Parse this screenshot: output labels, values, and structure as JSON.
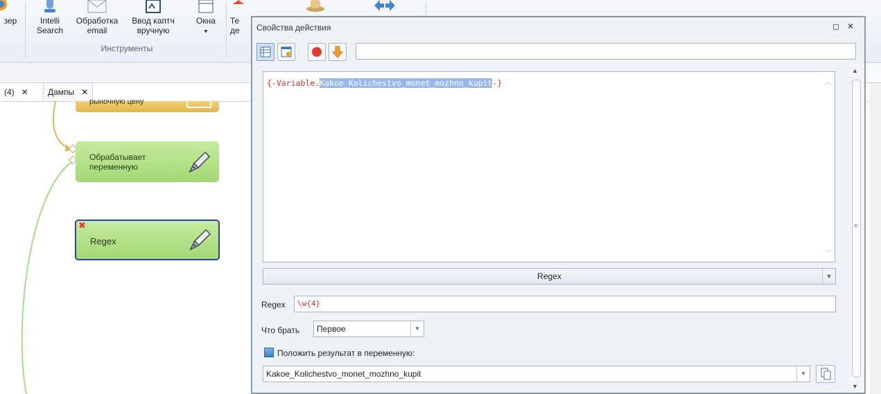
{
  "ribbon": {
    "browser_label": "зер",
    "intelli_line1": "Intelli",
    "intelli_line2": "Search",
    "email_line1": "Обработка",
    "email_line2": "email",
    "captcha_line1": "Ввод каптч",
    "captcha_line2": "вручную",
    "windows_label": "Окна",
    "windows_arrow": "▾",
    "partial_line1": "Те",
    "partial_line2": "де",
    "group_tools": "Инструменты"
  },
  "tabs": {
    "tab1_label": "(4)",
    "tab2_label": "Дампы",
    "close_glyph": "✕"
  },
  "canvas": {
    "node_top_label": "рыночную цену",
    "node_process_label_line1": "Обрабатывает",
    "node_process_label_line2": "переменную",
    "node_regex_label": "Regex"
  },
  "dialog": {
    "title": "Свойства действия",
    "restore_glyph": "◻",
    "close_glyph": "✕",
    "toolbar_input_value": "",
    "code_prefix": "{-Variable.",
    "code_highlight": "Kakoe_Kolichestvo_monet_mozhno_kupit",
    "code_suffix": "-}",
    "mode_value": "Regex",
    "regex_label": "Regex",
    "regex_value": "\\w{4}",
    "take_label": "Что брать",
    "take_value": "Первое",
    "store_label": "Положить результат в переменную:",
    "store_value": "Kakoe_Kolichestvo_monet_mozhno_kupit"
  },
  "colors": {
    "node_green": "#a2d874",
    "node_orange": "#e3b547",
    "selection_border": "#2d3fb8",
    "variable_red": "#d9312b",
    "highlight_blue": "#98b8ec"
  }
}
